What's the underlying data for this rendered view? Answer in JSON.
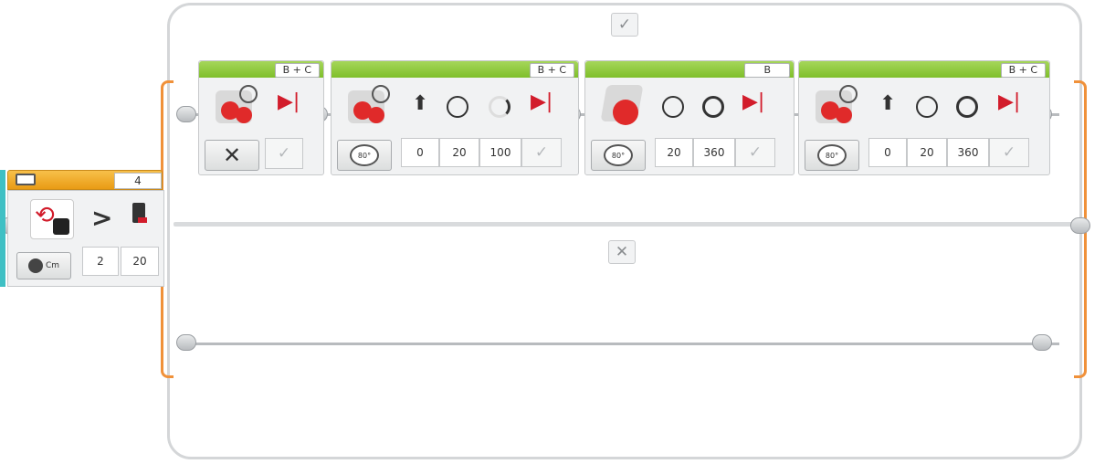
{
  "switch": {
    "true_case_icon": "check-icon",
    "false_case_icon": "cross-icon",
    "true_case_glyph": "✓",
    "false_case_glyph": "✕"
  },
  "loop_block": {
    "port_label": "4",
    "mode_icon": "count-icon",
    "mode_label": "Cm",
    "compare_symbol": ">",
    "compare_type_value": "2",
    "threshold_value": "20"
  },
  "blocks": [
    {
      "port": "B + C",
      "type": "steering",
      "mode": "off",
      "mode_glyph": "✕",
      "params": [],
      "check": "✓"
    },
    {
      "port": "B + C",
      "type": "steering",
      "mode": "degrees",
      "mode_glyph": "80°",
      "params": [
        "0",
        "20",
        "100"
      ],
      "check": "✓"
    },
    {
      "port": "B",
      "type": "large-motor",
      "mode": "degrees",
      "mode_glyph": "80°",
      "params": [
        "20",
        "360"
      ],
      "check": "✓"
    },
    {
      "port": "B + C",
      "type": "steering",
      "mode": "degrees",
      "mode_glyph": "80°",
      "params": [
        "0",
        "20",
        "360"
      ],
      "check": "✓"
    }
  ],
  "colors": {
    "block_header": "#7fbf2a",
    "loop_header": "#f0a020",
    "switch_accent": "#f0913a",
    "frame": "#d4d6d8"
  }
}
